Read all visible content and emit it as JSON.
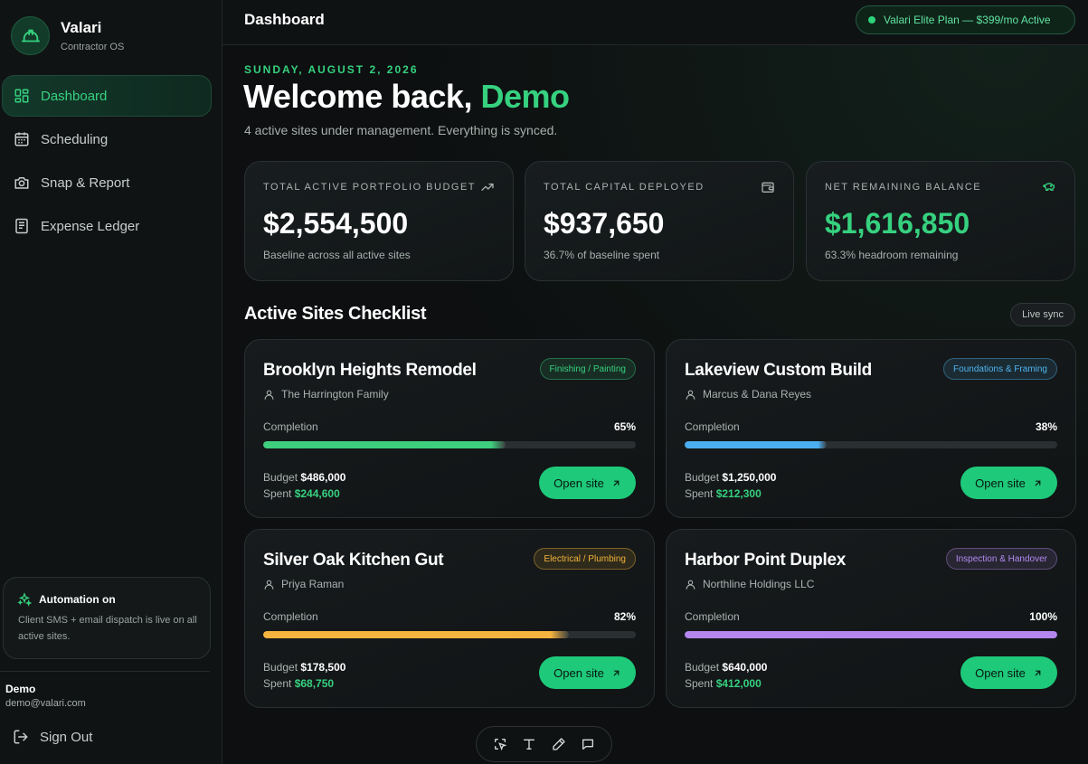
{
  "brand": {
    "name": "Valari",
    "subtitle": "Contractor OS"
  },
  "nav": [
    {
      "label": "Dashboard",
      "icon": "grid-icon",
      "active": true
    },
    {
      "label": "Scheduling",
      "icon": "calendar-icon",
      "active": false
    },
    {
      "label": "Snap & Report",
      "icon": "camera-icon",
      "active": false
    },
    {
      "label": "Expense Ledger",
      "icon": "ledger-icon",
      "active": false
    }
  ],
  "automation": {
    "title": "Automation on",
    "text": "Client SMS + email dispatch is live on all active sites."
  },
  "user": {
    "name": "Demo",
    "email": "demo@valari.com",
    "signout": "Sign Out"
  },
  "header": {
    "title": "Dashboard",
    "plan": "Valari Elite Plan — $399/mo Active"
  },
  "welcome": {
    "date": "SUNDAY, AUGUST 2, 2026",
    "greeting": "Welcome back, ",
    "name": "Demo",
    "subtitle": "4 active sites under management. Everything is synced."
  },
  "stats": [
    {
      "label": "TOTAL ACTIVE PORTFOLIO BUDGET",
      "value": "$2,554,500",
      "note": "Baseline across all active sites",
      "icon": "trending-up-icon"
    },
    {
      "label": "TOTAL CAPITAL DEPLOYED",
      "value": "$937,650",
      "note": "36.7% of baseline spent",
      "icon": "wallet-icon"
    },
    {
      "label": "NET REMAINING BALANCE",
      "value": "$1,616,850",
      "note": "63.3% headroom remaining",
      "icon": "piggy-bank-icon"
    }
  ],
  "sites_section": {
    "title": "Active Sites Checklist",
    "live": "Live sync"
  },
  "sites": [
    {
      "name": "Brooklyn Heights Remodel",
      "tag": "Finishing / Painting",
      "tag_color": "#36d17f",
      "client": "The Harrington Family",
      "completion_label": "Completion",
      "completion": 65,
      "completion_text": "65%",
      "bar_color": "#3ecf7e",
      "budget_label": "Budget",
      "budget": "$486,000",
      "spent_label": "Spent",
      "spent": "$244,600",
      "button": "Open site"
    },
    {
      "name": "Lakeview Custom Build",
      "tag": "Foundations & Framing",
      "tag_color": "#4fb3f0",
      "client": "Marcus & Dana Reyes",
      "completion_label": "Completion",
      "completion": 38,
      "completion_text": "38%",
      "bar_color": "#4aaef0",
      "budget_label": "Budget",
      "budget": "$1,250,000",
      "spent_label": "Spent",
      "spent": "$212,300",
      "button": "Open site"
    },
    {
      "name": "Silver Oak Kitchen Gut",
      "tag": "Electrical / Plumbing",
      "tag_color": "#f2b23a",
      "client": "Priya Raman",
      "completion_label": "Completion",
      "completion": 82,
      "completion_text": "82%",
      "bar_color": "#f5b43d",
      "budget_label": "Budget",
      "budget": "$178,500",
      "spent_label": "Spent",
      "spent": "$68,750",
      "button": "Open site"
    },
    {
      "name": "Harbor Point Duplex",
      "tag": "Inspection & Handover",
      "tag_color": "#b38af0",
      "client": "Northline Holdings LLC",
      "completion_label": "Completion",
      "completion": 100,
      "completion_text": "100%",
      "bar_color": "#b486ee",
      "budget_label": "Budget",
      "budget": "$640,000",
      "spent_label": "Spent",
      "spent": "$412,000",
      "button": "Open site"
    }
  ],
  "colors": {
    "accent": "#36d17f",
    "background": "#0d0f10",
    "card": "#171b1d"
  },
  "toolbar": [
    "select-icon",
    "text-icon",
    "pen-icon",
    "comment-icon"
  ]
}
